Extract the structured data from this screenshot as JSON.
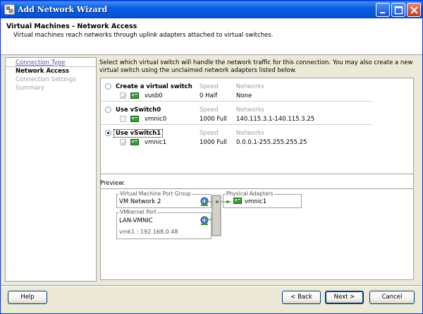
{
  "window": {
    "title": "Add Network Wizard"
  },
  "header": {
    "title": "Virtual Machines - Network Access",
    "description": "Virtual machines reach networks through uplink adapters attached to virtual switches."
  },
  "nav": [
    {
      "label": "Connection Type",
      "state": "link"
    },
    {
      "label": "Network Access",
      "state": "active"
    },
    {
      "label": "Connection Settings",
      "state": "disabled"
    },
    {
      "label": "Summary",
      "state": "disabled"
    }
  ],
  "instructions": "Select which virtual switch will handle the network traffic for this connection. You may also create a new virtual switch using the unclaimed network adapters listed below.",
  "columns": {
    "speed": "Speed",
    "networks": "Networks"
  },
  "switches": [
    {
      "label": "Create a virtual switch",
      "selected": false,
      "adapter": "vusb0",
      "speed": "0 Half",
      "networks": "None"
    },
    {
      "label": "Use vSwitch0",
      "selected": false,
      "adapter": "vmnic0",
      "speed": "1000 Full",
      "networks": "140.115.3.1-140.115.3.25"
    },
    {
      "label": "Use vSwitch1",
      "selected": true,
      "adapter": "vmnic1",
      "speed": "1000 Full",
      "networks": "0.0.0.1-255.255.255.25"
    }
  ],
  "preview": {
    "label": "Preview:",
    "vm_group_legend": "Virtual Machine Port Group",
    "vm_group_name": "VM Network 2",
    "vmkernel_legend": "VMkernel Port",
    "vmkernel_name": "LAN-VMNIC",
    "vmkernel_ip": "vmk1 : 192.168.0.48",
    "physical_legend": "Physical Adapters",
    "physical_adapter": "vmnic1"
  },
  "buttons": {
    "help": "Help",
    "back": "< Back",
    "next": "Next >",
    "cancel": "Cancel"
  },
  "colors": {
    "titlebar": "#0553d6",
    "nic_green": "#3a9a3a",
    "link": "#6b4fa8"
  }
}
